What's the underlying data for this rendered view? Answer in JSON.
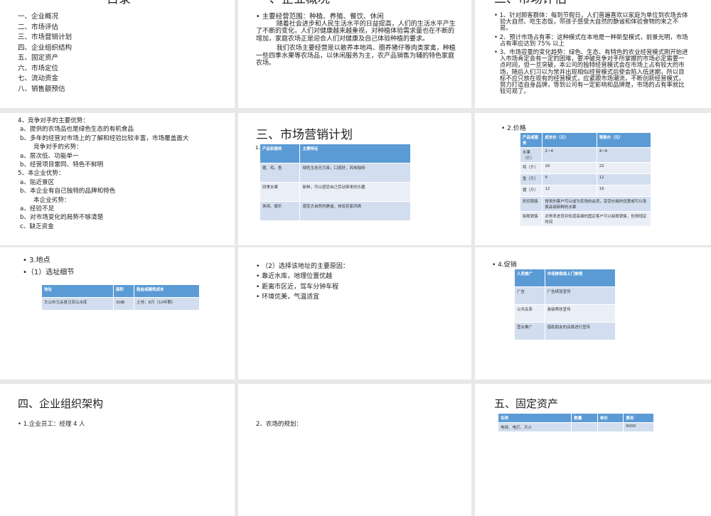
{
  "slides": {
    "toc": {
      "title": "目录",
      "items": [
        "一、企业概况",
        "二、市场评估",
        "三、市场营销计划",
        "四、企业组织结构",
        "五、固定资产",
        "六、市场定位",
        "七、流动资金",
        "八、销售额预估"
      ]
    },
    "overview": {
      "title": "一、企业概况",
      "bullet": "• 主要经营范围：种植、养殖、餐饮、休闲",
      "para1": "随着社会进步和人民生活水平的日益提高，人们的生活水平产生了不断的变化，人们对健康越来越重视，对种植体验需求量也在不断的增加，家庭农场正是迎合人们对健康及自己体验种植的要求。",
      "para2": "我们农场主要经营是以散养本地鸡、圈养猪仔等肉类家禽，种植一些四季水果等农场品，以休闲服务为主，农产品销售为辅的特色家庭农场。"
    },
    "assessment": {
      "title": "二、市场评估",
      "bullets": [
        "• 1、针对顾客群体：每到节假日，人们普遍喜欢以家庭为单位到农场去体验大自然、吃生态饭，带孩子感受大自然的静谧和体验食物的来之不易。",
        "• 2、预计市场占有率：这种模式在本地是一种新型模式，前景光明，市场占有率应达到 75% 以上",
        "• 3、市场容量的变化趋势：绿色、生态、有特色的农业经营模式刚开始进入市场肯定会有一定的困难，要冲破竞争对手所掌握的市场必定需要一点时间，但一旦突破，本公司的独特经营模式会在市场上占有较大的市场，随后人们习以为常并出现相似经营模式后使会陷入低迷期，所以目标不应只放在现有的经营模式，应紧跟市场潮流，不断创新经营模式，努力打造自身品牌，等到公司有一定影响和品牌是，市场的占有率就比较可观了。"
      ]
    },
    "competition": {
      "lines": [
        "4、竞争对手的主要优势：",
        "a、提供的农场品也是绿色生态的有机食品",
        "b、多年的经营对市场上的了解和经验比较丰富，市场覆盖面大",
        "竞争对手的劣势：",
        "a、层次低、功能单一",
        "b、经营项目雷同、特色不鲜明",
        "5、本企业优势：",
        "a、贴近景区",
        "b、本企业有自己独特的品牌和特色",
        "本企业劣势：",
        "a、经验不足",
        "b、对市场变化的局势不够清楚",
        "c、缺乏资金"
      ]
    },
    "marketing": {
      "title": "三、市场营销计划",
      "number": "1.",
      "table": [
        [
          "产品和服务",
          "主要特征"
        ],
        [
          "猪、鸡、鱼",
          "绿色生态无污染，口感好，风味独特"
        ],
        [
          "四季水果",
          "新鲜，可以感受自己劳动带来的乐趣"
        ],
        [
          "休闲、娱乐",
          "感受大自然的静谧，体验农家风情"
        ]
      ]
    },
    "price": {
      "heading": "• 2.价格",
      "table": [
        [
          "产品或服务",
          "成本价（元）",
          "销售价（元）"
        ],
        [
          "水果（斤）",
          "2~4",
          "4~6"
        ],
        [
          "鸡（斤）",
          "16",
          "22"
        ],
        [
          "鱼（斤）",
          "9",
          "12"
        ],
        [
          "猪（斤）",
          "12",
          "16"
        ],
        [
          "折扣销售",
          "常来的客户可以成为农场的会员，享受价格的优惠或可以免费品尝新鲜的水果"
        ],
        [
          "赊账销售",
          "对常来进货并知道底细的固定客户可以赊账销售，但得规定时间"
        ]
      ]
    },
    "location": {
      "heading": "• 3.地点",
      "sub": "•（1）选址细节",
      "table": [
        [
          "地址",
          "面积",
          "租金或建筑成本"
        ],
        [
          "文山市马关县马安山水库",
          "30亩",
          "土地：8万（10年期）"
        ]
      ]
    },
    "reasons": {
      "lines": [
        "• （2）选择该地址的主要原因：",
        "• 靠近水库，地理位置优越",
        "• 距离市区近，驾车分钟车程",
        "• 环境优美，气温适宜"
      ]
    },
    "promotion": {
      "heading": "• 4.促销",
      "table": [
        [
          "人员推广",
          "市场推销或上门推销"
        ],
        [
          "广告",
          "广告纸张宣传"
        ],
        [
          "公共关系",
          "县级帮扶宣传"
        ],
        [
          "营业推广",
          "借助朋友的店面进行宣传"
        ]
      ]
    },
    "org": {
      "title": "四、企业组织架构",
      "line": "• 1.企业员工：经理 4 人"
    },
    "plan": {
      "line": "2、农场的规划："
    },
    "assets": {
      "title": "五、固定资产",
      "table": [
        [
          "名称",
          "数量",
          "单价",
          "费用"
        ],
        [
          "电线、电灯、灭火",
          "",
          "",
          "6000"
        ]
      ]
    }
  }
}
